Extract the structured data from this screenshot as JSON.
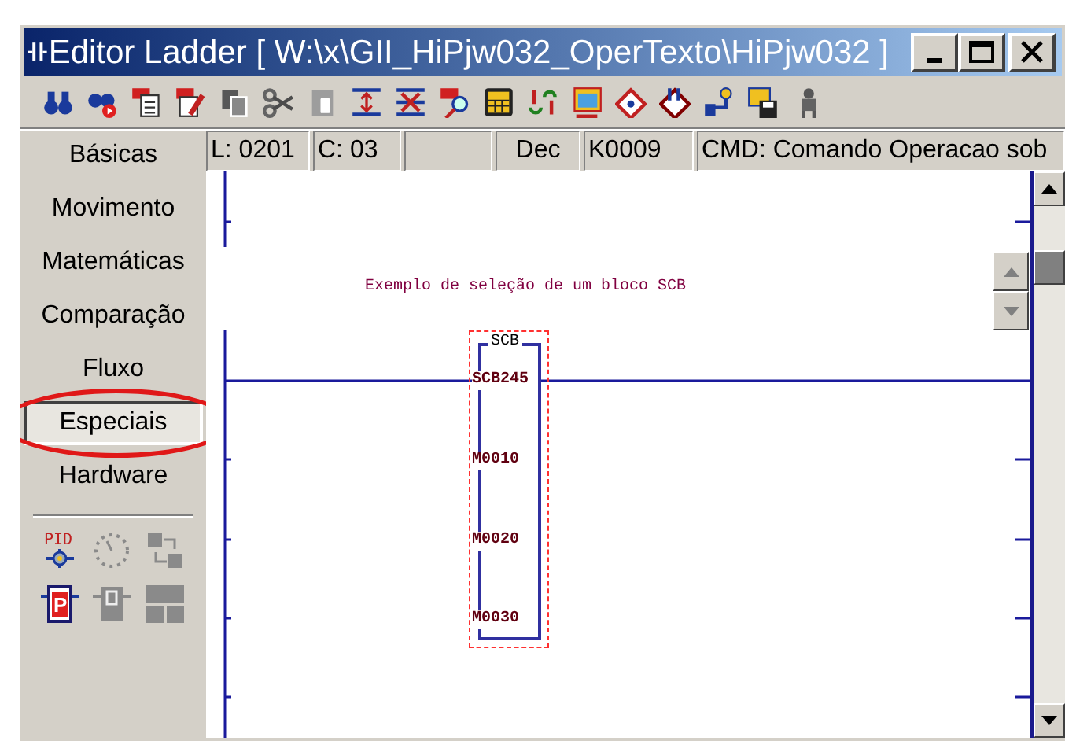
{
  "window": {
    "title": "Editor Ladder [ W:\\x\\GII_HiPjw032_OperTexto\\HiPjw032 ]"
  },
  "toolbar": [
    {
      "kind": "binoculars",
      "disabled": false
    },
    {
      "kind": "binoculars-run",
      "disabled": false
    },
    {
      "kind": "op-list",
      "disabled": false
    },
    {
      "kind": "op-edit",
      "disabled": false
    },
    {
      "kind": "copy",
      "disabled": true
    },
    {
      "kind": "cut",
      "disabled": true
    },
    {
      "kind": "paste",
      "disabled": true
    },
    {
      "kind": "insert-line",
      "disabled": false
    },
    {
      "kind": "delete-line",
      "disabled": false
    },
    {
      "kind": "op-search",
      "disabled": false
    },
    {
      "kind": "calculator",
      "disabled": false
    },
    {
      "kind": "arrows",
      "disabled": false
    },
    {
      "kind": "window",
      "disabled": false
    },
    {
      "kind": "diamond",
      "disabled": false
    },
    {
      "kind": "diamond-dark",
      "disabled": false
    },
    {
      "kind": "connector",
      "disabled": false
    },
    {
      "kind": "floppy",
      "disabled": false
    },
    {
      "kind": "figure",
      "disabled": true
    }
  ],
  "status_bar": {
    "line": "L: 0201",
    "column": "C: 03",
    "base": "Dec",
    "constant": "K0009",
    "command": "CMD: Comando Operacao sob"
  },
  "sidebar": {
    "items": [
      {
        "label": "Básicas",
        "selected": false,
        "highlighted": false
      },
      {
        "label": "Movimento",
        "selected": false,
        "highlighted": false
      },
      {
        "label": "Matemáticas",
        "selected": false,
        "highlighted": false
      },
      {
        "label": "Comparação",
        "selected": false,
        "highlighted": false
      },
      {
        "label": "Fluxo",
        "selected": false,
        "highlighted": false
      },
      {
        "label": "Especiais",
        "selected": true,
        "highlighted": true
      },
      {
        "label": "Hardware",
        "selected": false,
        "highlighted": false
      }
    ],
    "palette": [
      {
        "kind": "pid",
        "label": "PID",
        "disabled": false
      },
      {
        "kind": "clock",
        "disabled": true
      },
      {
        "kind": "transfer",
        "disabled": true
      },
      {
        "kind": "p-block",
        "label": "P",
        "disabled": false
      },
      {
        "kind": "g-block",
        "disabled": true
      },
      {
        "kind": "grid",
        "disabled": true
      }
    ]
  },
  "ladder": {
    "comment": "Exemplo de seleção de um bloco SCB",
    "block": {
      "title": "SCB",
      "selected": true,
      "operands": [
        "SCB245",
        "M0010",
        "M0020",
        "M0030"
      ]
    }
  }
}
